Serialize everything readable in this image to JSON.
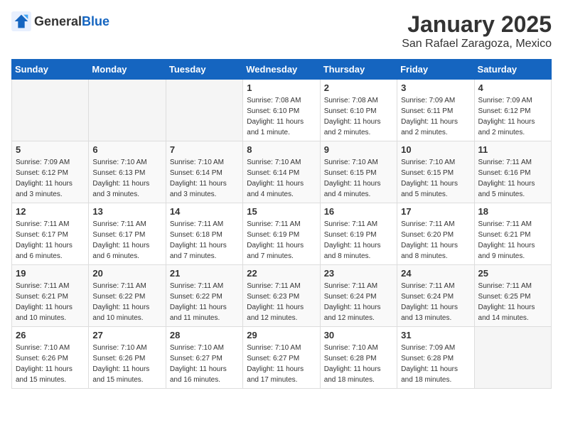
{
  "header": {
    "logo_general": "General",
    "logo_blue": "Blue",
    "month": "January 2025",
    "location": "San Rafael Zaragoza, Mexico"
  },
  "weekdays": [
    "Sunday",
    "Monday",
    "Tuesday",
    "Wednesday",
    "Thursday",
    "Friday",
    "Saturday"
  ],
  "weeks": [
    [
      {
        "day": "",
        "sunrise": "",
        "sunset": "",
        "daylight": ""
      },
      {
        "day": "",
        "sunrise": "",
        "sunset": "",
        "daylight": ""
      },
      {
        "day": "",
        "sunrise": "",
        "sunset": "",
        "daylight": ""
      },
      {
        "day": "1",
        "sunrise": "Sunrise: 7:08 AM",
        "sunset": "Sunset: 6:10 PM",
        "daylight": "Daylight: 11 hours and 1 minute."
      },
      {
        "day": "2",
        "sunrise": "Sunrise: 7:08 AM",
        "sunset": "Sunset: 6:10 PM",
        "daylight": "Daylight: 11 hours and 2 minutes."
      },
      {
        "day": "3",
        "sunrise": "Sunrise: 7:09 AM",
        "sunset": "Sunset: 6:11 PM",
        "daylight": "Daylight: 11 hours and 2 minutes."
      },
      {
        "day": "4",
        "sunrise": "Sunrise: 7:09 AM",
        "sunset": "Sunset: 6:12 PM",
        "daylight": "Daylight: 11 hours and 2 minutes."
      }
    ],
    [
      {
        "day": "5",
        "sunrise": "Sunrise: 7:09 AM",
        "sunset": "Sunset: 6:12 PM",
        "daylight": "Daylight: 11 hours and 3 minutes."
      },
      {
        "day": "6",
        "sunrise": "Sunrise: 7:10 AM",
        "sunset": "Sunset: 6:13 PM",
        "daylight": "Daylight: 11 hours and 3 minutes."
      },
      {
        "day": "7",
        "sunrise": "Sunrise: 7:10 AM",
        "sunset": "Sunset: 6:14 PM",
        "daylight": "Daylight: 11 hours and 3 minutes."
      },
      {
        "day": "8",
        "sunrise": "Sunrise: 7:10 AM",
        "sunset": "Sunset: 6:14 PM",
        "daylight": "Daylight: 11 hours and 4 minutes."
      },
      {
        "day": "9",
        "sunrise": "Sunrise: 7:10 AM",
        "sunset": "Sunset: 6:15 PM",
        "daylight": "Daylight: 11 hours and 4 minutes."
      },
      {
        "day": "10",
        "sunrise": "Sunrise: 7:10 AM",
        "sunset": "Sunset: 6:15 PM",
        "daylight": "Daylight: 11 hours and 5 minutes."
      },
      {
        "day": "11",
        "sunrise": "Sunrise: 7:11 AM",
        "sunset": "Sunset: 6:16 PM",
        "daylight": "Daylight: 11 hours and 5 minutes."
      }
    ],
    [
      {
        "day": "12",
        "sunrise": "Sunrise: 7:11 AM",
        "sunset": "Sunset: 6:17 PM",
        "daylight": "Daylight: 11 hours and 6 minutes."
      },
      {
        "day": "13",
        "sunrise": "Sunrise: 7:11 AM",
        "sunset": "Sunset: 6:17 PM",
        "daylight": "Daylight: 11 hours and 6 minutes."
      },
      {
        "day": "14",
        "sunrise": "Sunrise: 7:11 AM",
        "sunset": "Sunset: 6:18 PM",
        "daylight": "Daylight: 11 hours and 7 minutes."
      },
      {
        "day": "15",
        "sunrise": "Sunrise: 7:11 AM",
        "sunset": "Sunset: 6:19 PM",
        "daylight": "Daylight: 11 hours and 7 minutes."
      },
      {
        "day": "16",
        "sunrise": "Sunrise: 7:11 AM",
        "sunset": "Sunset: 6:19 PM",
        "daylight": "Daylight: 11 hours and 8 minutes."
      },
      {
        "day": "17",
        "sunrise": "Sunrise: 7:11 AM",
        "sunset": "Sunset: 6:20 PM",
        "daylight": "Daylight: 11 hours and 8 minutes."
      },
      {
        "day": "18",
        "sunrise": "Sunrise: 7:11 AM",
        "sunset": "Sunset: 6:21 PM",
        "daylight": "Daylight: 11 hours and 9 minutes."
      }
    ],
    [
      {
        "day": "19",
        "sunrise": "Sunrise: 7:11 AM",
        "sunset": "Sunset: 6:21 PM",
        "daylight": "Daylight: 11 hours and 10 minutes."
      },
      {
        "day": "20",
        "sunrise": "Sunrise: 7:11 AM",
        "sunset": "Sunset: 6:22 PM",
        "daylight": "Daylight: 11 hours and 10 minutes."
      },
      {
        "day": "21",
        "sunrise": "Sunrise: 7:11 AM",
        "sunset": "Sunset: 6:22 PM",
        "daylight": "Daylight: 11 hours and 11 minutes."
      },
      {
        "day": "22",
        "sunrise": "Sunrise: 7:11 AM",
        "sunset": "Sunset: 6:23 PM",
        "daylight": "Daylight: 11 hours and 12 minutes."
      },
      {
        "day": "23",
        "sunrise": "Sunrise: 7:11 AM",
        "sunset": "Sunset: 6:24 PM",
        "daylight": "Daylight: 11 hours and 12 minutes."
      },
      {
        "day": "24",
        "sunrise": "Sunrise: 7:11 AM",
        "sunset": "Sunset: 6:24 PM",
        "daylight": "Daylight: 11 hours and 13 minutes."
      },
      {
        "day": "25",
        "sunrise": "Sunrise: 7:11 AM",
        "sunset": "Sunset: 6:25 PM",
        "daylight": "Daylight: 11 hours and 14 minutes."
      }
    ],
    [
      {
        "day": "26",
        "sunrise": "Sunrise: 7:10 AM",
        "sunset": "Sunset: 6:26 PM",
        "daylight": "Daylight: 11 hours and 15 minutes."
      },
      {
        "day": "27",
        "sunrise": "Sunrise: 7:10 AM",
        "sunset": "Sunset: 6:26 PM",
        "daylight": "Daylight: 11 hours and 15 minutes."
      },
      {
        "day": "28",
        "sunrise": "Sunrise: 7:10 AM",
        "sunset": "Sunset: 6:27 PM",
        "daylight": "Daylight: 11 hours and 16 minutes."
      },
      {
        "day": "29",
        "sunrise": "Sunrise: 7:10 AM",
        "sunset": "Sunset: 6:27 PM",
        "daylight": "Daylight: 11 hours and 17 minutes."
      },
      {
        "day": "30",
        "sunrise": "Sunrise: 7:10 AM",
        "sunset": "Sunset: 6:28 PM",
        "daylight": "Daylight: 11 hours and 18 minutes."
      },
      {
        "day": "31",
        "sunrise": "Sunrise: 7:09 AM",
        "sunset": "Sunset: 6:28 PM",
        "daylight": "Daylight: 11 hours and 18 minutes."
      },
      {
        "day": "",
        "sunrise": "",
        "sunset": "",
        "daylight": ""
      }
    ]
  ]
}
